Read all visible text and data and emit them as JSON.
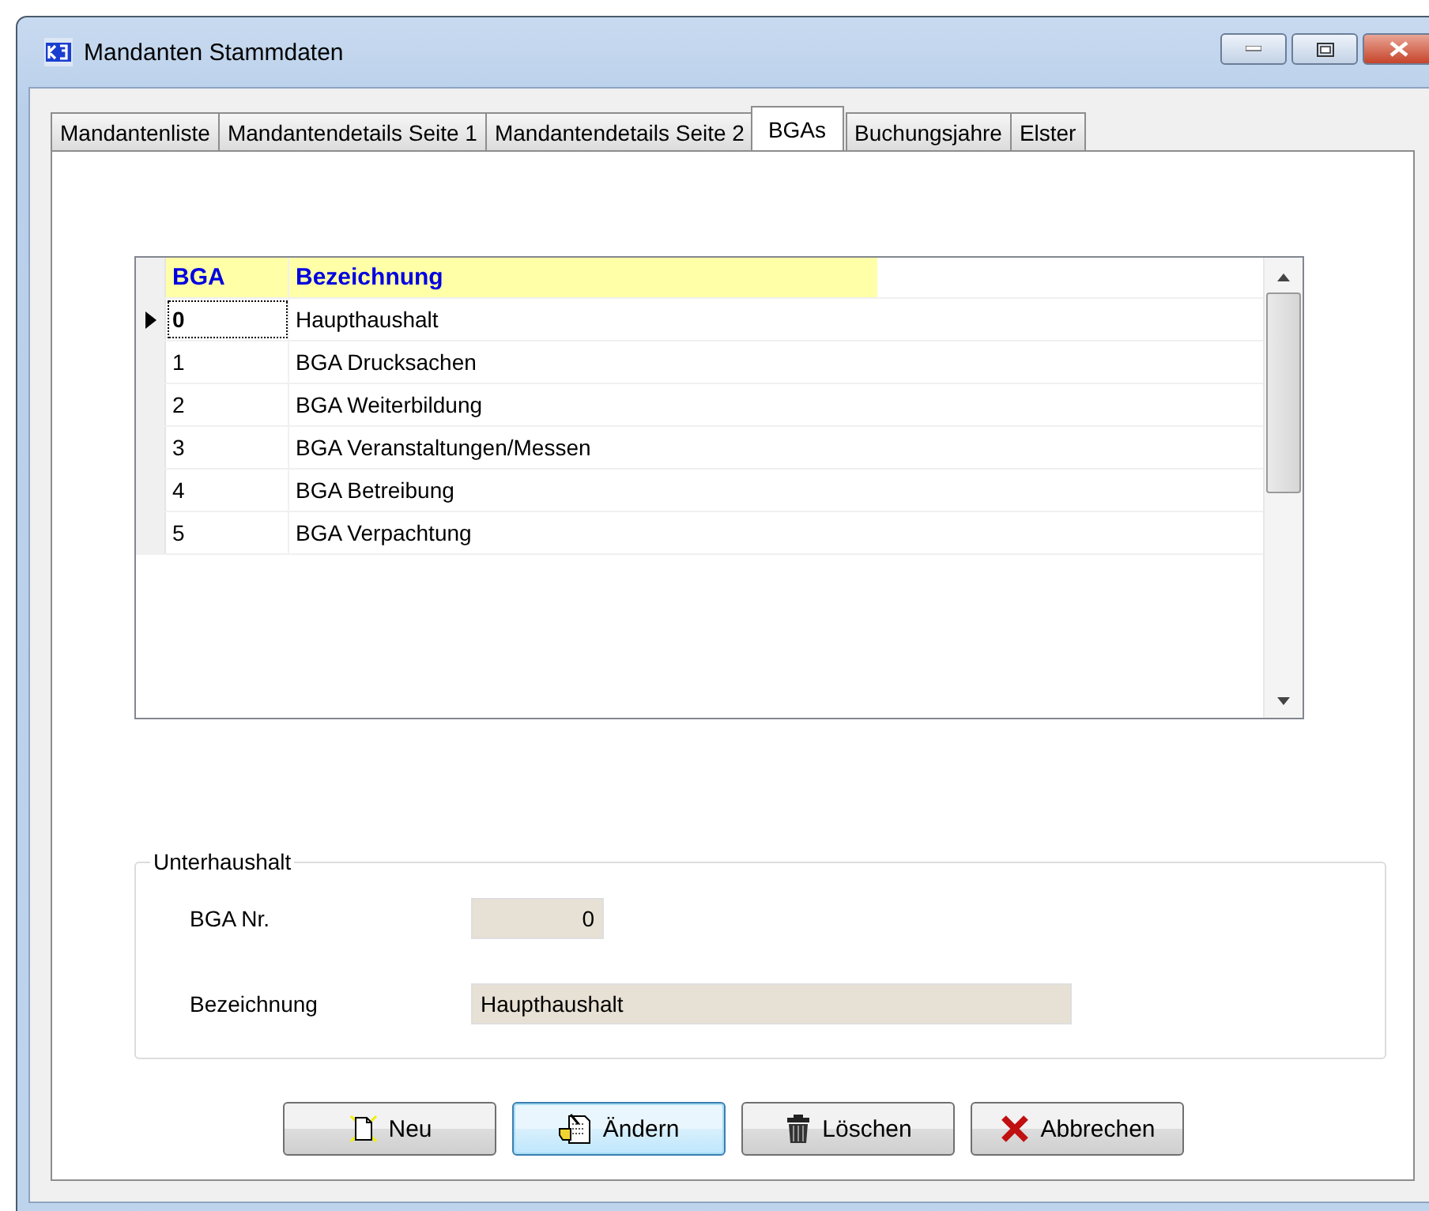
{
  "window": {
    "title": "Mandanten Stammdaten"
  },
  "tabs": [
    {
      "label": "Mandantenliste",
      "selected": false
    },
    {
      "label": "Mandantendetails Seite 1",
      "selected": false
    },
    {
      "label": "Mandantendetails Seite 2",
      "selected": false
    },
    {
      "label": "BGAs",
      "selected": true
    },
    {
      "label": "Buchungsjahre",
      "selected": false
    },
    {
      "label": "Elster",
      "selected": false
    }
  ],
  "table": {
    "columns": [
      "BGA",
      "Bezeichnung"
    ],
    "rows": [
      {
        "cells": [
          "0",
          "Haupthaushalt"
        ],
        "selected": true
      },
      {
        "cells": [
          "1",
          "BGA Drucksachen"
        ],
        "selected": false
      },
      {
        "cells": [
          "2",
          "BGA Weiterbildung"
        ],
        "selected": false
      },
      {
        "cells": [
          "3",
          "BGA Veranstaltungen/Messen"
        ],
        "selected": false
      },
      {
        "cells": [
          "4",
          "BGA Betreibung"
        ],
        "selected": false
      },
      {
        "cells": [
          "5",
          "BGA Verpachtung"
        ],
        "selected": false
      }
    ]
  },
  "group": {
    "title": "Unterhaushalt",
    "fields": [
      {
        "label": "BGA Nr.",
        "value": "0",
        "kind": "number"
      },
      {
        "label": "Bezeichnung",
        "value": "Haupthaushalt",
        "kind": "text"
      }
    ]
  },
  "buttons": [
    {
      "label": "Neu",
      "kind": "new",
      "focused": false
    },
    {
      "label": "Ändern",
      "kind": "edit",
      "focused": true
    },
    {
      "label": "Löschen",
      "kind": "delete",
      "focused": false
    },
    {
      "label": "Abbrechen",
      "kind": "cancel",
      "focused": false
    }
  ]
}
